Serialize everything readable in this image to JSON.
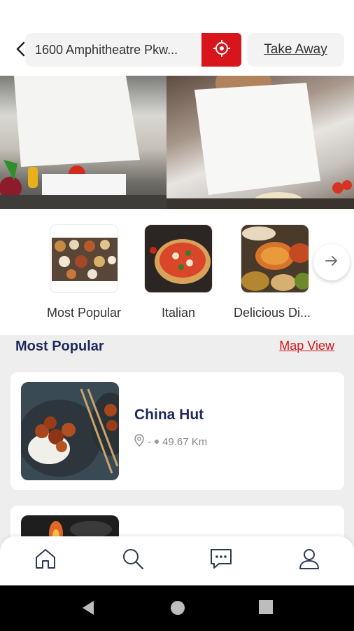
{
  "header": {
    "address": "1600 Amphitheatre Pkw...",
    "take_away_label": "Take Away",
    "accent_color": "#d7151b"
  },
  "banner": {
    "slides": [
      "chef-preparing-vegetables",
      "chef-plating-dish"
    ],
    "active_index": 0,
    "dot_count": 3
  },
  "categories": {
    "items": [
      {
        "label": "Most Popular",
        "icon": "assorted-dishes"
      },
      {
        "label": "Italian",
        "icon": "pizza"
      },
      {
        "label": "Delicious Di...",
        "icon": "indian-curries"
      }
    ],
    "next_icon": "arrow-right-icon"
  },
  "listing": {
    "section_title": "Most Popular",
    "map_view_label": "Map View",
    "restaurants": [
      {
        "name": "China Hut",
        "rating": "-",
        "distance": "49.67 Km"
      }
    ]
  },
  "bottom_nav": {
    "items": [
      "home-icon",
      "search-icon",
      "chat-icon",
      "profile-icon"
    ]
  },
  "system_nav": [
    "back",
    "home",
    "recents"
  ]
}
